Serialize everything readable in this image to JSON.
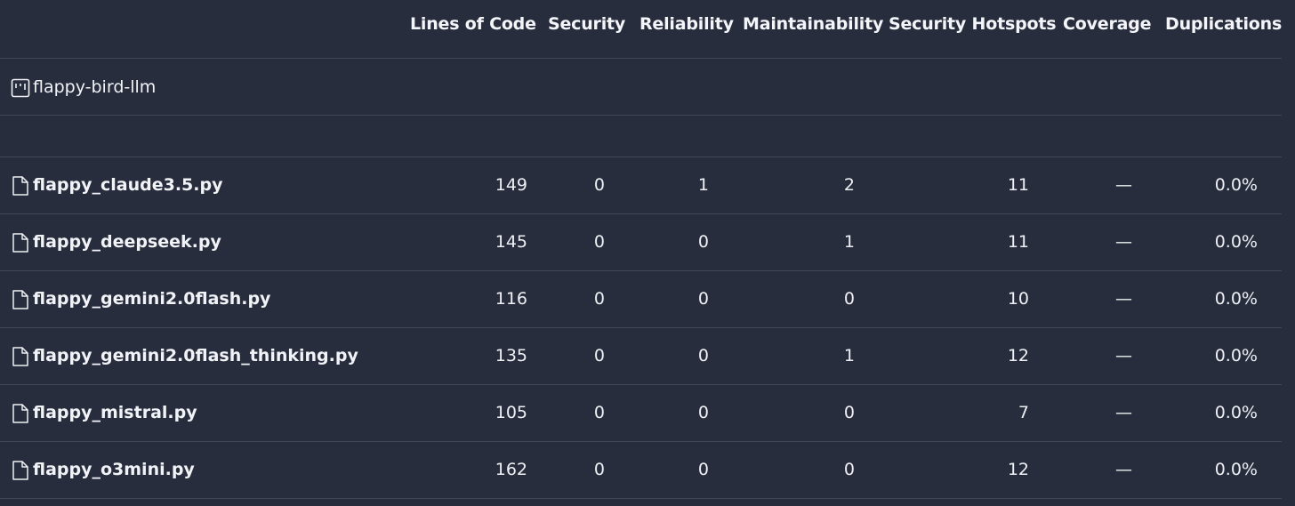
{
  "columns": {
    "loc": "Lines of Code",
    "security": "Security",
    "reliability": "Reliability",
    "maintainability": "Maintainability",
    "hotspots": "Security Hotspots",
    "coverage": "Coverage",
    "duplications": "Duplications"
  },
  "project": {
    "name": "flappy-bird-llm",
    "icon": "project-icon"
  },
  "files": [
    {
      "name": "flappy_claude3.5.py",
      "loc": "149",
      "security": "0",
      "reliability": "1",
      "maintainability": "2",
      "hotspots": "11",
      "coverage": "—",
      "duplications": "0.0%"
    },
    {
      "name": "flappy_deepseek.py",
      "loc": "145",
      "security": "0",
      "reliability": "0",
      "maintainability": "1",
      "hotspots": "11",
      "coverage": "—",
      "duplications": "0.0%"
    },
    {
      "name": "flappy_gemini2.0flash.py",
      "loc": "116",
      "security": "0",
      "reliability": "0",
      "maintainability": "0",
      "hotspots": "10",
      "coverage": "—",
      "duplications": "0.0%"
    },
    {
      "name": "flappy_gemini2.0flash_thinking.py",
      "loc": "135",
      "security": "0",
      "reliability": "0",
      "maintainability": "1",
      "hotspots": "12",
      "coverage": "—",
      "duplications": "0.0%"
    },
    {
      "name": "flappy_mistral.py",
      "loc": "105",
      "security": "0",
      "reliability": "0",
      "maintainability": "0",
      "hotspots": "7",
      "coverage": "—",
      "duplications": "0.0%"
    },
    {
      "name": "flappy_o3mini.py",
      "loc": "162",
      "security": "0",
      "reliability": "0",
      "maintainability": "0",
      "hotspots": "12",
      "coverage": "—",
      "duplications": "0.0%"
    }
  ],
  "icons": {
    "file": "file-icon"
  },
  "colors": {
    "background": "#282d3e",
    "divider": "#404658",
    "text": "#f1f3f7"
  }
}
